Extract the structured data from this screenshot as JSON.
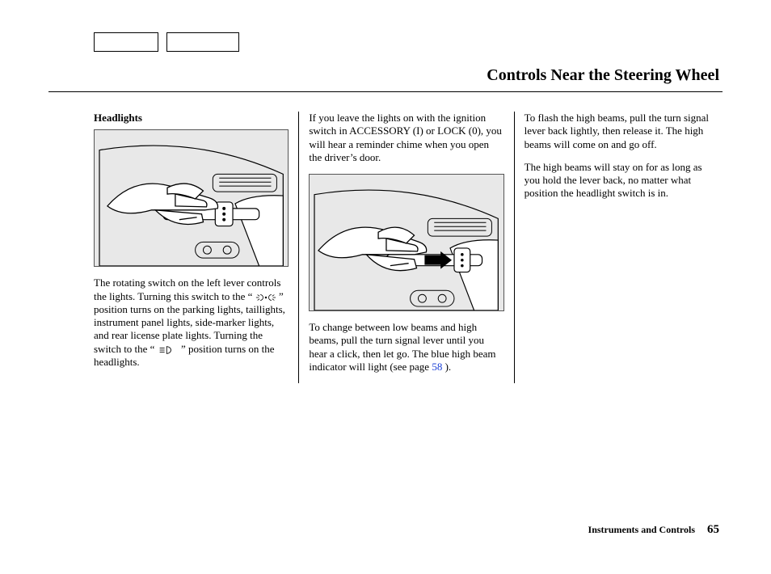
{
  "pageTitle": "Controls Near the Steering Wheel",
  "section": {
    "heading": "Headlights"
  },
  "column1": {
    "p1_a": "The rotating switch on the left lever controls the lights. Turning this switch to the “ ",
    "p1_b": " ” position turns on the parking lights, taillights, instrument panel lights, side-marker lights, and rear license plate lights. Turning the switch to the “ ",
    "p1_c": " ” position turns on the headlights."
  },
  "column2": {
    "p1": "If you leave the lights on with the ignition switch in ACCESSORY (I) or LOCK (0), you will hear a reminder chime when you open the driver’s door.",
    "p2_a": "To change between low beams and high beams, pull the turn signal lever until you hear a click, then let go. The blue high beam indicator will light (see page ",
    "p2_link": "58",
    "p2_b": " )."
  },
  "column3": {
    "p1": "To flash the high beams, pull the turn signal lever back lightly, then release it. The high beams will come on and go off.",
    "p2": "The high beams will stay on for as long as you hold the lever back, no matter what position the headlight switch is in."
  },
  "footer": {
    "sectionLabel": "Instruments and Controls",
    "pageNumber": "65"
  }
}
